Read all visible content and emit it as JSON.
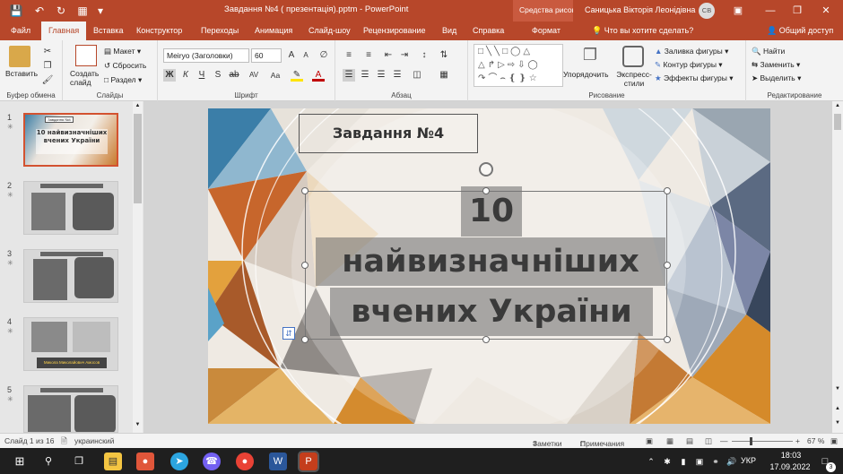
{
  "titlebar": {
    "doc_title": "Завдання №4 ( презентація).pptm  -  PowerPoint",
    "context_group": "Средства рисование",
    "user_name": "Саницька Вікторія Леонідівна",
    "avatar_initials": "СВ"
  },
  "tabs": [
    "Файл",
    "Главная",
    "Вставка",
    "Конструктор",
    "Переходы",
    "Анимация",
    "Слайд-шоу",
    "Рецензирование",
    "Вид",
    "Справка",
    "Формат"
  ],
  "active_tab": "Главная",
  "tell_me": "Что вы хотите сделать?",
  "share": "Общий доступ",
  "ribbon": {
    "clipboard": {
      "paste": "Вставить",
      "label": "Буфер обмена"
    },
    "slides": {
      "new_slide": "Создать слайд",
      "layout": "Макет",
      "reset": "Сбросить",
      "section": "Раздел",
      "label": "Слайды"
    },
    "font": {
      "name": "Meiryo (Заголовки)",
      "size": "60",
      "bold": "Ж",
      "italic": "К",
      "underline": "Ч",
      "strike": "S",
      "spacing": "AV",
      "case": "Aa",
      "label": "Шрифт"
    },
    "paragraph": {
      "label": "Абзац"
    },
    "drawing": {
      "arrange": "Упорядочить",
      "quick_styles": "Экспресс-стили",
      "fill": "Заливка фигуры",
      "outline": "Контур фигуры",
      "effects": "Эффекты фигуры",
      "label": "Рисование"
    },
    "editing": {
      "find": "Найти",
      "replace": "Заменить",
      "select": "Выделить",
      "label": "Редактирование"
    }
  },
  "slides_panel": [
    {
      "num": "1",
      "title_box": "Завдання №4",
      "title": "10 найвизначніших вчених України",
      "active": true
    },
    {
      "num": "2",
      "active": false
    },
    {
      "num": "3",
      "active": false
    },
    {
      "num": "4",
      "caption": "Микола Миколайович Амосов",
      "active": false
    },
    {
      "num": "5",
      "active": false
    }
  ],
  "slide": {
    "task_label": "Завдання №4",
    "title_line1": "10",
    "title_line2": "найвизначніших",
    "title_line3": "вчених України"
  },
  "statusbar": {
    "slide_info": "Слайд 1 из 16",
    "language": "украинский",
    "notes": "Заметки",
    "comments": "Примечания",
    "zoom": "67 %"
  },
  "taskbar": {
    "language": "УКР",
    "time": "18:03",
    "date": "17.09.2022",
    "notif_count": "3"
  },
  "colors": {
    "accent": "#b7472a",
    "selected_thumb": "#d35230"
  }
}
